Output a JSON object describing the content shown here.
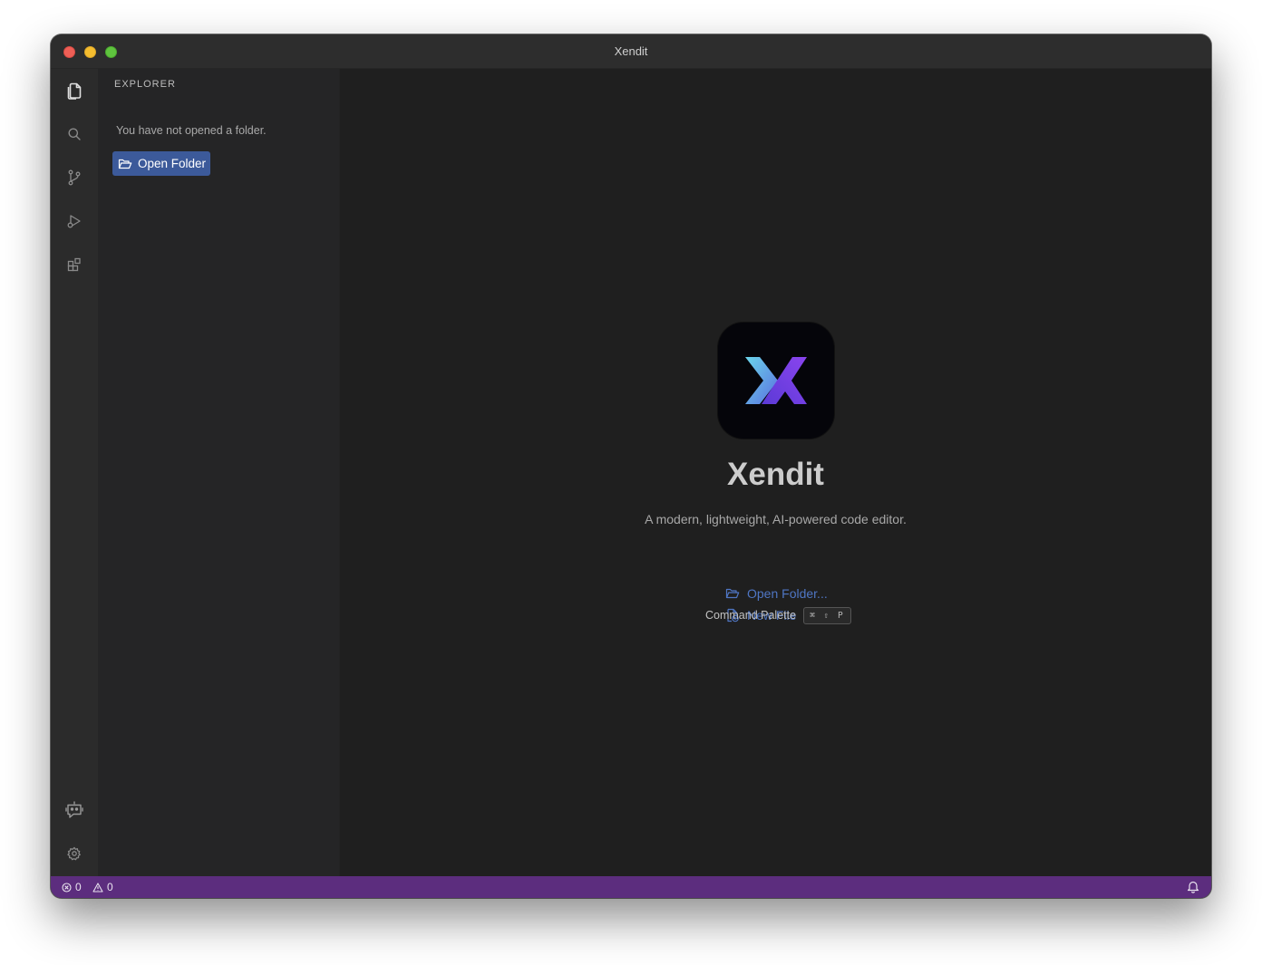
{
  "window": {
    "title": "Xendit"
  },
  "activity_bar": {
    "items": [
      {
        "name": "explorer",
        "icon": "files-icon",
        "active": true
      },
      {
        "name": "search",
        "icon": "search-icon"
      },
      {
        "name": "source-control",
        "icon": "source-control-icon"
      },
      {
        "name": "run-debug",
        "icon": "run-debug-icon"
      },
      {
        "name": "extensions",
        "icon": "extensions-icon"
      }
    ],
    "bottom_items": [
      {
        "name": "ai-assistant",
        "icon": "robot-icon"
      },
      {
        "name": "settings",
        "icon": "gear-icon"
      }
    ]
  },
  "sidebar": {
    "title": "EXPLORER",
    "empty_message": "You have not opened a folder.",
    "open_folder_label": "Open Folder"
  },
  "welcome": {
    "app_name": "Xendit",
    "tagline": "A modern, lightweight, AI-powered code editor.",
    "open_folder_label": "Open Folder...",
    "new_file_label": "New File",
    "command_palette_label": "Command Palette",
    "command_palette_shortcut": "⌘ ⇧ P"
  },
  "status_bar": {
    "errors": "0",
    "warnings": "0",
    "color": "#5c2d7e"
  },
  "colors": {
    "accent": "#3c5a9a",
    "link": "#4f76c4",
    "logo_start": "#5ad1e6",
    "logo_end": "#7b3fe4"
  }
}
